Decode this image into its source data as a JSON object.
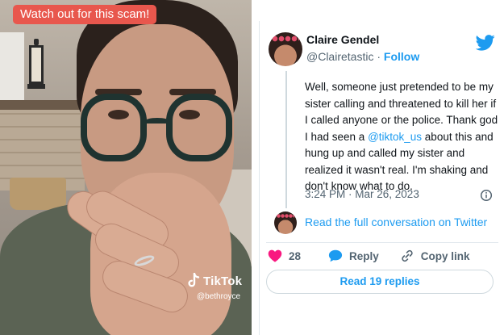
{
  "video": {
    "caption": "Watch out for this scam!",
    "watermark_brand": "TikTok",
    "watermark_user": "@bethroyce"
  },
  "tweet": {
    "author_name": "Claire Gendel",
    "handle": "@Clairetastic",
    "separator": " · ",
    "follow_label": "Follow",
    "body_before_mention": "Well, someone just pretended to be my sister calling and threatened to kill her if I called anyone or the police. Thank god I had seen a ",
    "mention": "@tiktok_us",
    "body_after_mention": " about this and hung up and called my sister and realized it wasn't real. I'm shaking and don't know what to do.",
    "timestamp": "3:24 PM · Mar 26, 2023",
    "read_conversation_label": "Read the full conversation on Twitter",
    "like_count": "28",
    "reply_label": "Reply",
    "copy_link_label": "Copy link",
    "read_replies_label": "Read 19 replies"
  },
  "colors": {
    "caption_bg": "#e8574d",
    "twitter_blue": "#1d9bf0",
    "like_red": "#f91880",
    "text_primary": "#0f1419",
    "text_secondary": "#536471"
  },
  "icons": {
    "twitter": "twitter-bird-icon",
    "info": "info-icon",
    "like": "heart-icon",
    "reply": "speech-bubble-icon",
    "copy": "link-icon",
    "tiktok": "tiktok-note-icon"
  }
}
